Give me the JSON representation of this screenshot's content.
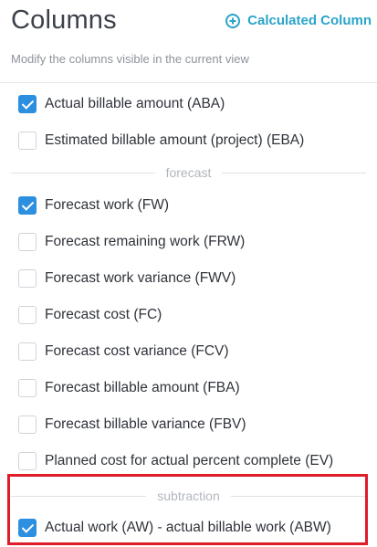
{
  "header": {
    "title": "Columns",
    "calculated_column_label": "Calculated Column",
    "subtitle": "Modify the columns visible in the current view"
  },
  "items_top": [
    {
      "label": "Actual billable amount (ABA)",
      "checked": true
    },
    {
      "label": "Estimated billable amount (project) (EBA)",
      "checked": false
    }
  ],
  "groups": {
    "forecast": "forecast",
    "subtraction": "subtraction"
  },
  "items_forecast": [
    {
      "label": "Forecast work (FW)",
      "checked": true
    },
    {
      "label": "Forecast remaining work (FRW)",
      "checked": false
    },
    {
      "label": "Forecast work variance (FWV)",
      "checked": false
    },
    {
      "label": "Forecast cost (FC)",
      "checked": false
    },
    {
      "label": "Forecast cost variance (FCV)",
      "checked": false
    },
    {
      "label": "Forecast billable amount (FBA)",
      "checked": false
    },
    {
      "label": "Forecast billable variance (FBV)",
      "checked": false
    },
    {
      "label": "Planned cost for actual percent complete (EV)",
      "checked": false
    }
  ],
  "items_subtraction": [
    {
      "label": "Actual work (AW) - actual billable work (ABW)",
      "checked": true
    }
  ],
  "colors": {
    "accent": "#2aa4c9",
    "checkbox_checked": "#2d8fe0",
    "highlight": "#e01b2a"
  }
}
